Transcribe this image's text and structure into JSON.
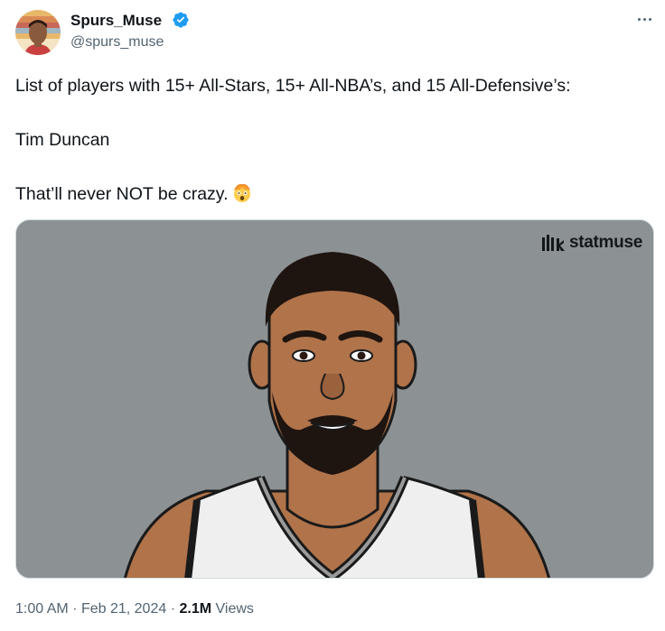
{
  "author": {
    "display_name": "Spurs_Muse",
    "handle": "@spurs_muse",
    "verified": true,
    "verified_color": "#1d9bf0"
  },
  "more_icon": "more-horizontal-icon",
  "tweet": {
    "lines": [
      "List of players with 15+ All-Stars, 15+ All-NBA’s, and 15 All-Defensive’s:",
      "Tim Duncan",
      "That’ll never NOT be crazy."
    ],
    "emoji": "exploding-head-emoji"
  },
  "media": {
    "brand": "statmuse",
    "background_color": "#8c9194",
    "subject": "illustrated player portrait"
  },
  "meta": {
    "time": "1:00 AM",
    "separator": "·",
    "date": "Feb 21, 2024",
    "views_count": "2.1M",
    "views_label": "Views"
  }
}
